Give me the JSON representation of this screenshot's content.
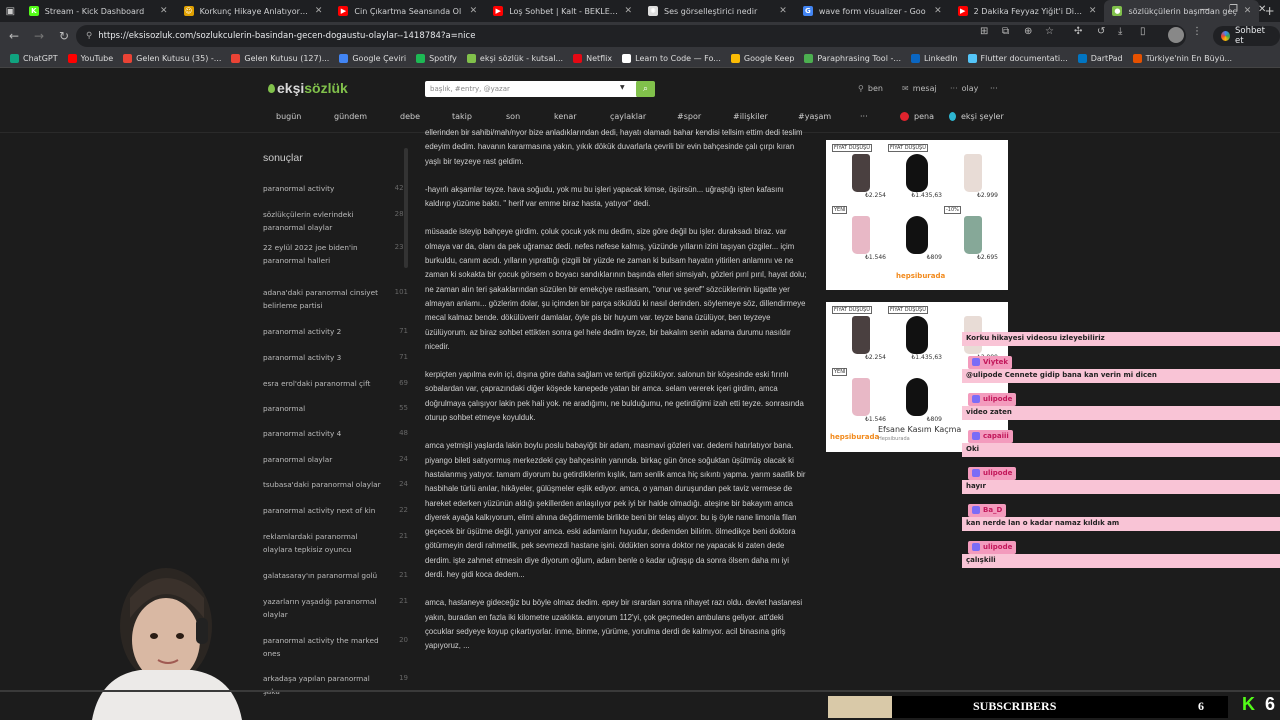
{
  "browser": {
    "tabs": [
      {
        "title": "Stream - Kick Dashboard",
        "color": "#53fc18",
        "glyph": "K"
      },
      {
        "title": "Korkunç Hikaye Anlatıyorum",
        "color": "#e0a000",
        "glyph": "☺"
      },
      {
        "title": "Cin Çıkartma Seansında Ol",
        "color": "#ff0000",
        "glyph": "▶"
      },
      {
        "title": "Loş Sohbet | Kalt - BEKLENE",
        "color": "#ff0000",
        "glyph": "▶"
      },
      {
        "title": "Ses görselleştirici nedir",
        "color": "#dddddd",
        "glyph": "✺"
      },
      {
        "title": "wave form visualizer - Goo",
        "color": "#4285f4",
        "glyph": "G"
      },
      {
        "title": "2 Dakika Feyyaz Yiğit'i Dinle",
        "color": "#ff0000",
        "glyph": "▶"
      },
      {
        "title": "sözlükçülerin başından geç",
        "color": "#81c14b",
        "glyph": "●"
      }
    ],
    "url": "https://eksisozluk.com/sozlukculerin-basindan-gecen-dogaustu-olaylar--1418784?a=nice",
    "sohbet_label": "Sohbet et",
    "bookmarks": [
      {
        "label": "ChatGPT",
        "color": "#10a37f"
      },
      {
        "label": "YouTube",
        "color": "#ff0000"
      },
      {
        "label": "Gelen Kutusu (35) -...",
        "color": "#ea4335"
      },
      {
        "label": "Gelen Kutusu (127)...",
        "color": "#ea4335"
      },
      {
        "label": "Google Çeviri",
        "color": "#4285f4"
      },
      {
        "label": "Spotify",
        "color": "#1db954"
      },
      {
        "label": "ekşi sözlük - kutsal...",
        "color": "#81c14b"
      },
      {
        "label": "Netflix",
        "color": "#e50914"
      },
      {
        "label": "Learn to Code — Fo...",
        "color": "#ffffff"
      },
      {
        "label": "Google Keep",
        "color": "#fbbc05"
      },
      {
        "label": "Paraphrasing Tool -...",
        "color": "#4caf50"
      },
      {
        "label": "LinkedIn",
        "color": "#0a66c2"
      },
      {
        "label": "Flutter documentati...",
        "color": "#54c5f8"
      },
      {
        "label": "DartPad",
        "color": "#0175c2"
      },
      {
        "label": "Türkiye'nin En Büyü...",
        "color": "#e65100"
      }
    ]
  },
  "site": {
    "logo_prefix": "ekşi",
    "logo_suffix": "sözlük",
    "search_placeholder": "başlık, #entry, @yazar",
    "user_items": [
      "ben",
      "mesaj",
      "olay"
    ],
    "nav": [
      "bugün",
      "gündem",
      "debe",
      "takip",
      "son",
      "kenar",
      "çaylaklar",
      "#spor",
      "#ilişkiler",
      "#yaşam",
      "···",
      "pena",
      "ekşi şeyler"
    ]
  },
  "sidebar": {
    "heading": "sonuçlar",
    "items": [
      {
        "label": "paranormal activity",
        "count": "421"
      },
      {
        "label": "sözlükçülerin evlerindeki paranormal olaylar",
        "count": "282"
      },
      {
        "label": "22 eylül 2022 joe biden'in paranormal halleri",
        "count": "230"
      },
      {
        "label": "adana'daki paranormal cinsiyet belirleme partisi",
        "count": "101"
      },
      {
        "label": "paranormal activity 2",
        "count": "71"
      },
      {
        "label": "paranormal activity 3",
        "count": "71"
      },
      {
        "label": "esra erol'daki paranormal çift",
        "count": "69"
      },
      {
        "label": "paranormal",
        "count": "55"
      },
      {
        "label": "paranormal activity 4",
        "count": "48"
      },
      {
        "label": "paranormal olaylar",
        "count": "24"
      },
      {
        "label": "tsubasa'daki paranormal olaylar",
        "count": "24"
      },
      {
        "label": "paranormal activity next of kin",
        "count": "22"
      },
      {
        "label": "reklamlardaki paranormal olaylara tepkisiz oyuncu",
        "count": "21"
      },
      {
        "label": "galatasaray'ın paranormal golü",
        "count": "21"
      },
      {
        "label": "yazarların yaşadığı paranormal olaylar",
        "count": "21"
      },
      {
        "label": "paranormal activity the marked ones",
        "count": "20"
      },
      {
        "label": "arkadaşa yapılan paranormal şaka",
        "count": "19"
      }
    ]
  },
  "entry": {
    "paragraphs": [
      "ellerinden bir sahibi/mah/nyor bize anladıklarından dedi, hayatı olamadı bahar kendisi tellsim ettim dedi teslim edeyim dedim. havanın kararmasına yakın, yıkık dökük duvarlarla çevrili bir evin bahçesinde çalı çırpı kıran yaşlı bir teyzeye rast geldim.",
      "-hayırlı akşamlar teyze. hava soğudu, yok mu bu işleri yapacak kimse, üşürsün... uğraştığı işten kafasını kaldırıp yüzüme baktı. \" herif var emme biraz hasta, yatıyor\" dedi.",
      "müsaade isteyip bahçeye girdim. çoluk çocuk yok mu dedim, size göre değil bu işler. duraksadı biraz. var olmaya var da, olanı da pek uğramaz dedi. nefes nefese kalmış, yüzünde yılların izini taşıyan çizgiler... içim burkuldu, canım acıdı. yılların yıprattığı çizgili bir yüzde ne zaman ki bulsam hayatın yitirilen anlamını ve ne zaman ki sokakta bir çocuk görsem o boyacı sandıklarının başında elleri simsiyah, gözleri pırıl pırıl, hayat dolu; ne zaman alın teri şakaklarından süzülen bir emekçiye rastlasam, \"onur ve şeref\" sözcüklerinin lügatte yer almayan anlamı... gözlerim dolar, şu içimden bir parça söküldü ki nasıl derinden. söylemeye söz, dillendirmeye mecal kalmaz bende. dökülüverir damlalar, öyle pis bir huyum var. teyze bana üzülüyor, ben teyzeye üzülüyorum. az biraz sohbet ettikten sonra gel hele dedim teyze, bir bakalım senin adama durumu nasıldır nicedir.",
      "kerpiçten yapılma evin içi, dışına göre daha sağlam ve tertipli gözüküyor. salonun bir köşesinde eski fırınlı sobalardan var, çaprazındaki diğer köşede kanepede yatan bir amca. selam vererek içeri girdim, amca doğrulmaya çalışıyor lakin pek hali yok. ne aradığımı, ne bulduğumu, ne getirdiğimi izah etti teyze. sonrasında oturup sohbet etmeye koyulduk.",
      "amca yetmişli yaşlarda lakin boylu poslu babayiğit bir adam, masmavi gözleri var. dedemi hatırlatıyor bana. piyango bileti satıyormuş merkezdeki çay bahçesinin yanında. birkaç gün önce soğuktan üşütmüş olacak ki hastalanmış yatıyor. tamam diyorum bu getirdiklerim kışlık, tam senlik amca hiç sıkıntı yapma. yarım saatlik bir hasbihale türlü anılar, hikâyeler, gülüşmeler eşlik ediyor. amca, o yaman duruşundan pek taviz vermese de hareket ederken yüzünün aldığı şekillerden anlaşılıyor pek iyi bir halde olmadığı. ateşine bir bakayım amca diyerek ayağa kalkıyorum, elimi alnına değdirmemle birlikte beni bir telaş alıyor. bu iş öyle nane limonla filan geçecek bir üşütme değil, yanıyor amca. eski adamların huyudur, dedemden bilirim. ölmedikçe beni doktora götürmeyin derdi rahmetlik, pek sevmezdi hastane işini. öldükten sonra doktor ne yapacak ki zaten dede derdim. işte zahmet etmesin diye diyorum oğlum, adam benle o kadar uğraşıp da sonra ölsem daha mı iyi derdi. hey gidi koca dedem...",
      "amca, hastaneye gideceğiz bu böyle olmaz dedim. epey bir ısrardan sonra nihayet razı oldu. devlet hastanesi yakın, buradan en fazla iki kilometre uzaklıkta. arıyorum 112'yi, çok geçmeden ambulans geliyor. att'deki çocuklar sedyeye koyup çıkartıyorlar. inme, binme, yürüme, yorulma derdi de kalmıyor. acil binasına giriş yapıyoruz, ..."
    ]
  },
  "ads": {
    "tags": [
      "FİYAT DÜŞÜŞÜ",
      "FİYAT DÜŞÜŞÜ",
      "YENİ",
      "-10%"
    ],
    "prices": [
      "₺2.254",
      "₺1.435,63",
      "₺2.999",
      "₺1.546",
      "₺809",
      "₺2.695"
    ],
    "brand": "hepsiburada",
    "campaign": "Efsane Kasım Kaçma",
    "campaign_sub": "Hepsiburada"
  },
  "chat": [
    {
      "type": "msg",
      "text": "Korku hikayesi videosu izleyebiliriz"
    },
    {
      "type": "name",
      "text": "Viytek"
    },
    {
      "type": "msg",
      "text": "@ulipode Cennete gidip bana kan verin mi dicen"
    },
    {
      "type": "name",
      "text": "ulipode"
    },
    {
      "type": "msg",
      "text": "video zaten"
    },
    {
      "type": "name",
      "text": "capaiii"
    },
    {
      "type": "msg",
      "text": "Oki"
    },
    {
      "type": "name",
      "text": "ulipode"
    },
    {
      "type": "msg",
      "text": "hayır"
    },
    {
      "type": "name",
      "text": "Ba_D"
    },
    {
      "type": "msg",
      "text": "kan nerde lan o kadar namaz kıldık am"
    },
    {
      "type": "name",
      "text": "ulipode"
    },
    {
      "type": "msg",
      "text": "çalışkili"
    }
  ],
  "overlay": {
    "subscribers_label": "SUBSCRIBERS",
    "subscribers_count": "6",
    "goal_fill": 0.16,
    "kick_glyph": "K",
    "kick_count": "6"
  }
}
